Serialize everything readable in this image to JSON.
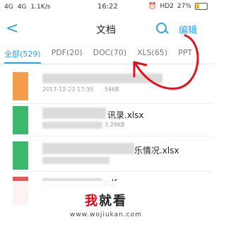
{
  "status_bar": {
    "network1": "4G",
    "network2": "4G",
    "speed": "1.1K/s",
    "time": "16:22",
    "hd": "HD2",
    "battery": "27%",
    "battery_level": 0.27
  },
  "nav": {
    "title": "文档",
    "edit_label": "编辑"
  },
  "tabs": [
    {
      "label": "全部(529)"
    },
    {
      "label": "PDF(20)"
    },
    {
      "label": "DOC(70)"
    },
    {
      "label": "XLS(65)"
    },
    {
      "label": "PPT"
    }
  ],
  "files": [
    {
      "name": "",
      "meta_date": "2017-12-23 17:35",
      "meta_size": "546B",
      "color": "#f39c4a"
    },
    {
      "name": "讯录.xlsx",
      "meta_date": "",
      "meta_size": "3.29KB",
      "color": "#3bb86a"
    },
    {
      "name": "乐情况.xlsx",
      "meta_date": "",
      "meta_size": "",
      "color": "#3bb86a"
    },
    {
      "name": "pdf",
      "meta_date": "",
      "meta_size": "",
      "color": "#e85a5a"
    }
  ],
  "watermark": {
    "brand_red": "我",
    "brand_black": "就看",
    "site": "www.wojiukan.com"
  },
  "colors": {
    "accent": "#2aa3e8",
    "annotation": "#e0141e"
  }
}
